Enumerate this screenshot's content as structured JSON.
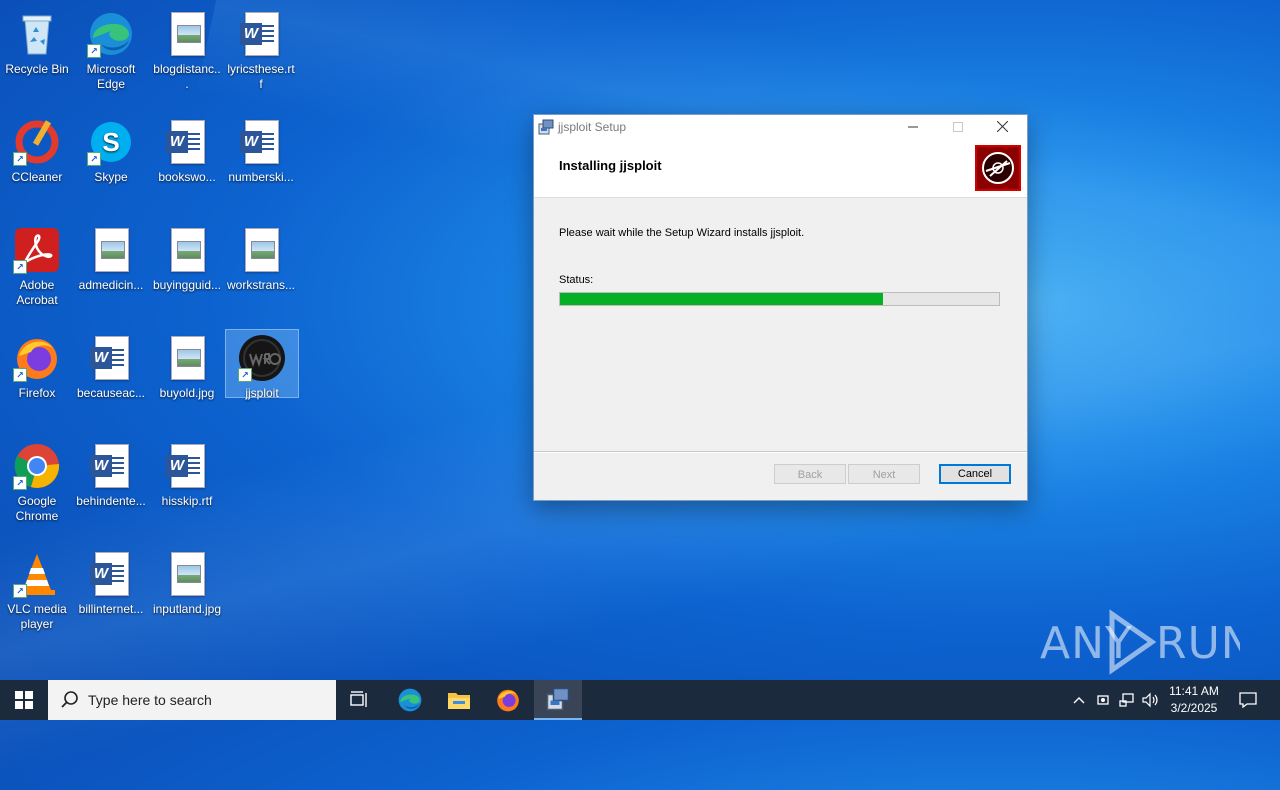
{
  "desktop": {
    "icons": [
      {
        "label": "Recycle Bin"
      },
      {
        "label": "Microsoft Edge"
      },
      {
        "label": "blogdistanc..."
      },
      {
        "label": "lyricsthese.rtf"
      },
      {
        "label": "CCleaner"
      },
      {
        "label": "Skype"
      },
      {
        "label": "bookswo..."
      },
      {
        "label": "numberski..."
      },
      {
        "label": "Adobe Acrobat"
      },
      {
        "label": "admedicin..."
      },
      {
        "label": "buyingguid..."
      },
      {
        "label": "workstrans..."
      },
      {
        "label": "Firefox"
      },
      {
        "label": "becauseac..."
      },
      {
        "label": "buyold.jpg"
      },
      {
        "label": "jjsploit"
      },
      {
        "label": "Google Chrome"
      },
      {
        "label": "behindente..."
      },
      {
        "label": "hisskip.rtf"
      },
      {
        "label": "VLC media player"
      },
      {
        "label": "billinternet..."
      },
      {
        "label": "inputland.jpg"
      }
    ]
  },
  "window": {
    "title": "jjsploit Setup",
    "header_title": "Installing jjsploit",
    "message": "Please wait while the Setup Wizard installs jjsploit.",
    "status_label": "Status:",
    "progress": 0.735,
    "buttons": {
      "back": "Back",
      "next": "Next",
      "cancel": "Cancel"
    }
  },
  "taskbar": {
    "search_placeholder": "Type here to search",
    "time": "11:41 AM",
    "date": "3/2/2025"
  },
  "watermark": {
    "text": "ANY RUN"
  },
  "colors": {
    "progress_fill": "#06b025",
    "taskbar": "#1c2a3e",
    "logo_bg": "#8b0000",
    "logo_border": "#d00000"
  }
}
